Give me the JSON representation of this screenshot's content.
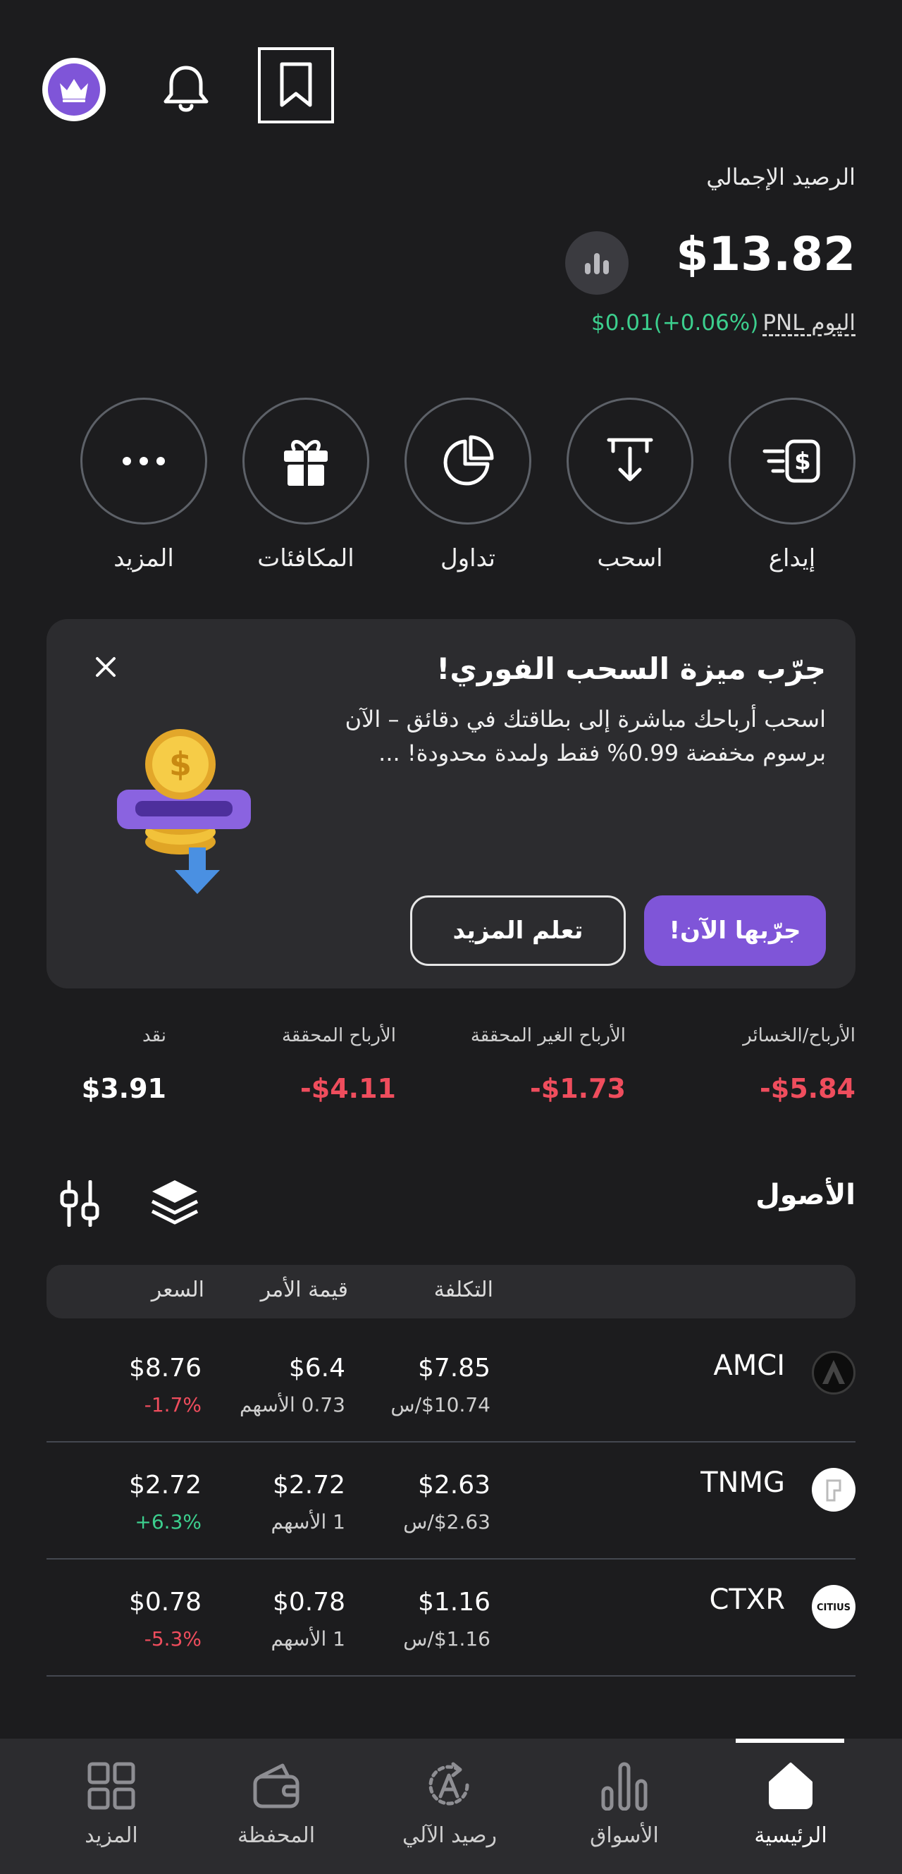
{
  "header": {
    "avatar_icon": "crown-icon",
    "bell_icon": "bell-icon",
    "bookmark_icon": "bookmark-icon"
  },
  "balance": {
    "label": "الرصيد الإجمالي",
    "value": "$13.82",
    "pnl_label": "PNL اليوم",
    "pnl_change": "$0.01(+0.06%)"
  },
  "actions": [
    {
      "label": "إيداع",
      "icon": "deposit-icon"
    },
    {
      "label": "اسحب",
      "icon": "withdraw-icon"
    },
    {
      "label": "تداول",
      "icon": "pie-chart-icon"
    },
    {
      "label": "المكافئات",
      "icon": "gift-icon"
    },
    {
      "label": "المزيد",
      "icon": "more-icon"
    }
  ],
  "promo": {
    "title": "جرّب ميزة السحب الفوري!",
    "body": "اسحب أرباحك مباشرة إلى بطاقتك في دقائق – الآن برسوم مخفضة 0.99% فقط ولمدة محدودة! ...",
    "primary_label": "جرّبها الآن!",
    "secondary_label": "تعلم المزيد"
  },
  "stats": [
    {
      "label": "الأرباح/الخسائر",
      "value": "-$5.84"
    },
    {
      "label": "الأرباح الغير المحققة",
      "value": "-$1.73"
    },
    {
      "label": "الأرباح المحققة",
      "value": "-$4.11"
    },
    {
      "label": "نقد",
      "value": "$3.91"
    }
  ],
  "assets": {
    "title": "الأصول",
    "columns": {
      "cost": "التكلفة",
      "order_value": "قيمة الأمر",
      "price": "السعر"
    },
    "rows": [
      {
        "ticker": "AMCI",
        "cost": "$7.85",
        "cost_sub": "$10.74/س",
        "order_value": "$6.4",
        "shares": "0.73 الأسهم",
        "price": "$8.76",
        "change": "-1.7%",
        "change_dir": "down"
      },
      {
        "ticker": "TNMG",
        "cost": "$2.63",
        "cost_sub": "$2.63/س",
        "order_value": "$2.72",
        "shares": "1 الأسهم",
        "price": "$2.72",
        "change": "+6.3%",
        "change_dir": "up"
      },
      {
        "ticker": "CTXR",
        "cost": "$1.16",
        "cost_sub": "$1.16/س",
        "order_value": "$0.78",
        "shares": "1 الأسهم",
        "price": "$0.78",
        "change": "-5.3%",
        "change_dir": "down"
      }
    ]
  },
  "nav": {
    "items": [
      {
        "label": "الرئيسية",
        "icon": "home-icon",
        "active": true
      },
      {
        "label": "الأسواق",
        "icon": "markets-icon",
        "active": false
      },
      {
        "label": "رصيد الآلي",
        "icon": "auto-balance-icon",
        "active": false
      },
      {
        "label": "المحفظة",
        "icon": "wallet-icon",
        "active": false
      },
      {
        "label": "المزيد",
        "icon": "grid-icon",
        "active": false
      }
    ]
  },
  "colors": {
    "accent": "#7f55d8",
    "positive": "#3ccf8e",
    "negative": "#ef4d5d",
    "background": "#1c1c1e",
    "card": "#2c2c2f"
  }
}
